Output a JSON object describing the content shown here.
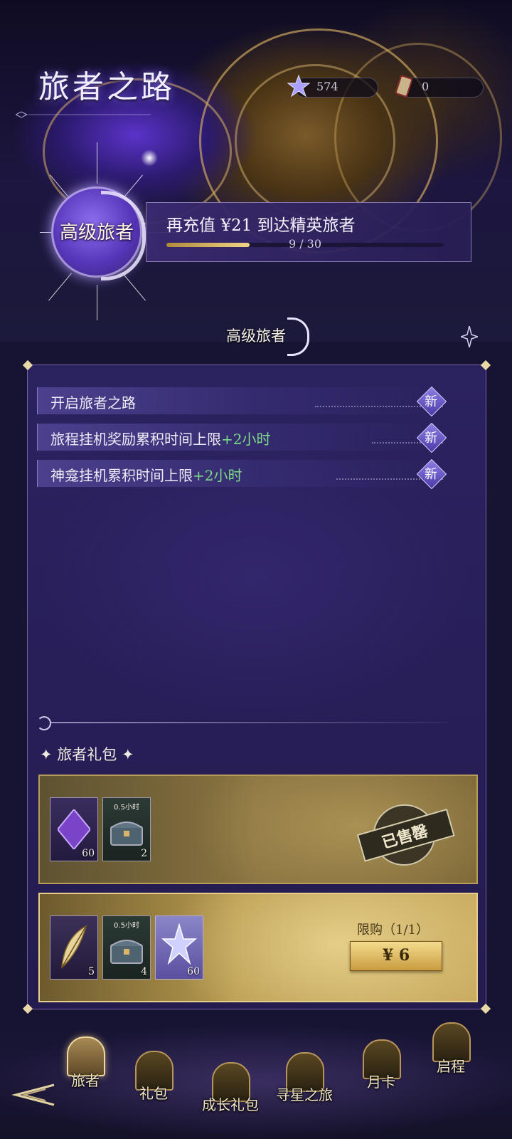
{
  "header": {
    "title": "旅者之路",
    "currencies": [
      {
        "name": "star-crystal",
        "value": "574"
      },
      {
        "name": "ticket",
        "value": "0"
      }
    ]
  },
  "tier": {
    "current": "高级旅者",
    "progress_text": "再充值 ¥21 到达精英旅者",
    "progress_count": "9 / 30",
    "progress_fraction": 0.3
  },
  "section_header": "高级旅者",
  "benefits": [
    {
      "text": "开启旅者之路",
      "highlight": "",
      "badge": "新"
    },
    {
      "text": "旅程挂机奖励累积时间上限",
      "highlight": "+2小时",
      "badge": "新"
    },
    {
      "text": "神龛挂机累积时间上限",
      "highlight": "+2小时",
      "badge": "新"
    }
  ],
  "gift_section_title": "旅者礼包",
  "gift_packs": [
    {
      "items": [
        {
          "icon": "purple-shard-icon",
          "tag": "",
          "qty": "60"
        },
        {
          "icon": "treasure-chest-icon",
          "tag": "0.5小时",
          "qty": "2"
        }
      ],
      "status": "已售罄"
    },
    {
      "items": [
        {
          "icon": "golden-feather-icon",
          "tag": "",
          "qty": "5"
        },
        {
          "icon": "treasure-chest-icon",
          "tag": "0.5小时",
          "qty": "4"
        },
        {
          "icon": "star-crystal-icon",
          "tag": "",
          "qty": "60"
        }
      ],
      "limit": "限购（1/1）",
      "price": "¥ 6"
    }
  ],
  "nav": {
    "tabs": [
      {
        "label": "旅者",
        "icon": "traveler-icon",
        "selected": true
      },
      {
        "label": "礼包",
        "icon": "gift-icon",
        "selected": false
      },
      {
        "label": "成长礼包",
        "icon": "growth-pack-icon",
        "selected": false
      },
      {
        "label": "寻星之旅",
        "icon": "star-journey-icon",
        "selected": false
      },
      {
        "label": "月卡",
        "icon": "monthly-card-icon",
        "selected": false
      },
      {
        "label": "启程",
        "icon": "departure-icon",
        "selected": false
      }
    ]
  },
  "colors": {
    "accent_gold": "#d9b56a",
    "highlight_green": "#7ddc86",
    "panel_purple": "#2b2260"
  }
}
